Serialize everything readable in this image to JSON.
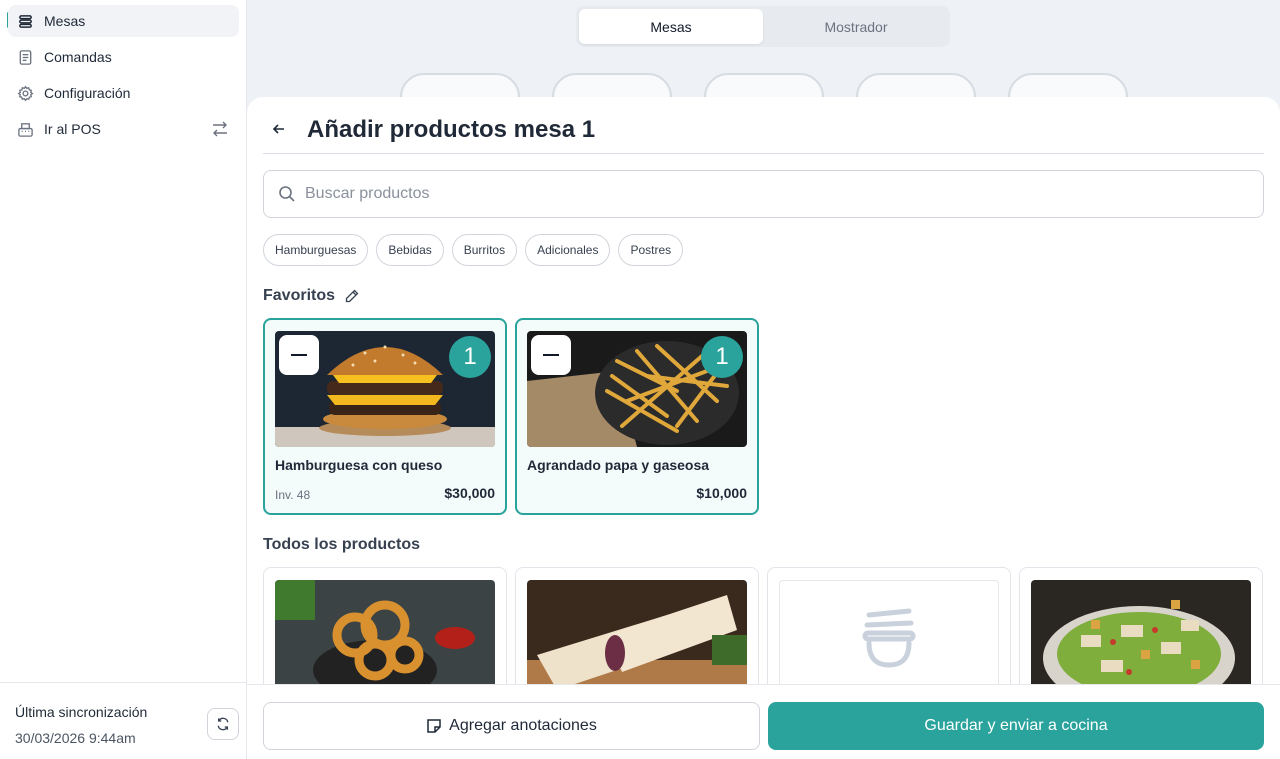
{
  "sidebar": {
    "items": [
      {
        "label": "Mesas",
        "icon": "stack-icon"
      },
      {
        "label": "Comandas",
        "icon": "receipt-icon"
      },
      {
        "label": "Configuración",
        "icon": "gear-icon"
      },
      {
        "label": "Ir al POS",
        "icon": "register-icon"
      }
    ],
    "sync_label": "Última sincronización",
    "sync_date": "30/03/2026 9:44am"
  },
  "tabs": [
    {
      "label": "Mesas",
      "selected": true
    },
    {
      "label": "Mostrador",
      "selected": false
    }
  ],
  "panel": {
    "title": "Añadir productos mesa 1",
    "search_placeholder": "Buscar productos",
    "categories": [
      "Hamburguesas",
      "Bebidas",
      "Burritos",
      "Adicionales",
      "Postres"
    ],
    "favorites_title": "Favoritos",
    "favorites": [
      {
        "name": "Hamburguesa con queso",
        "inventory": "Inv. 48",
        "price": "$30,000",
        "quantity": "1",
        "image": "burger"
      },
      {
        "name": "Agrandado papa y gaseosa",
        "inventory": "",
        "price": "$10,000",
        "quantity": "1",
        "image": "fries"
      }
    ],
    "all_title": "Todos los productos",
    "products": [
      {
        "image": "onion-rings"
      },
      {
        "image": "burrito"
      },
      {
        "image": "placeholder"
      },
      {
        "image": "salad"
      }
    ]
  },
  "actions": {
    "notes_label": "Agregar anotaciones",
    "save_label": "Guardar y enviar a cocina"
  },
  "colors": {
    "accent": "#2aa39c",
    "background": "#eef1f5"
  }
}
